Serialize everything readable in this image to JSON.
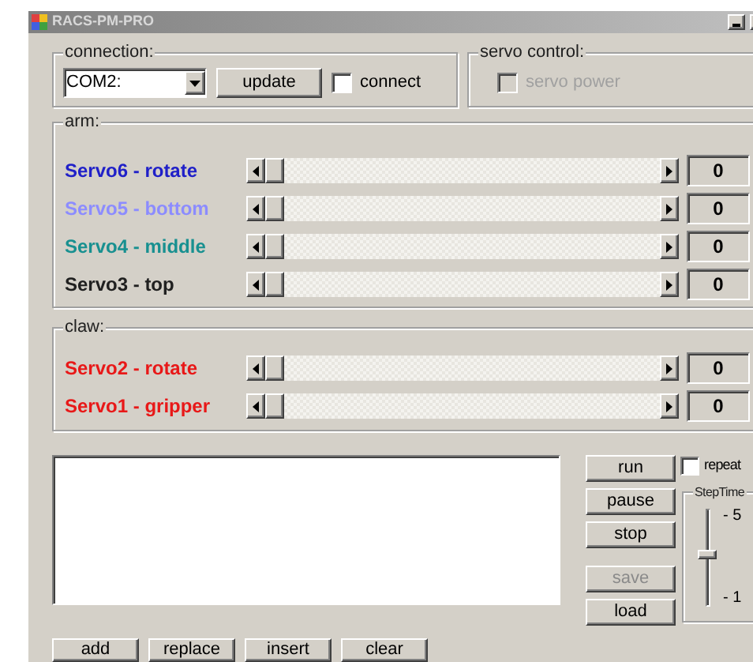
{
  "window": {
    "title": "RACS-PM-PRO"
  },
  "connection": {
    "title": "connection:",
    "port": "COM2:",
    "update_button": "update",
    "connect": {
      "label": "connect",
      "checked": false
    }
  },
  "servo_control": {
    "title": "servo control:",
    "servo_power": {
      "label": "servo power",
      "checked": false,
      "disabled": true
    }
  },
  "arm": {
    "title": "arm:",
    "servos": [
      {
        "name": "Servo6 - rotate",
        "color": "#2020c8",
        "level": 0,
        "value": "0"
      },
      {
        "name": "Servo5 - bottom",
        "color": "#8c8cff",
        "level": 0,
        "value": "0"
      },
      {
        "name": "Servo4 - middle",
        "color": "#189090",
        "level": 0,
        "value": "0"
      },
      {
        "name": "Servo3 - top",
        "color": "#202020",
        "level": 0,
        "value": "0"
      }
    ]
  },
  "claw": {
    "title": "claw:",
    "servos": [
      {
        "name": "Servo2 - rotate",
        "color": "#e81818",
        "level": 0,
        "value": "0"
      },
      {
        "name": "Servo1 - gripper",
        "color": "#e81818",
        "level": 0,
        "value": "0"
      }
    ]
  },
  "sequence_buttons": [
    {
      "label": "run",
      "disabled": false
    },
    {
      "label": "pause",
      "disabled": false
    },
    {
      "label": "stop",
      "disabled": false
    },
    {
      "label": "save",
      "disabled": true
    },
    {
      "label": "load",
      "disabled": false
    }
  ],
  "repeat": {
    "label": "repeat",
    "checked": false
  },
  "step_time": {
    "title": "StepTime",
    "max_label": "- 5",
    "min_label": "- 1",
    "level": 0.53
  },
  "edit_buttons": [
    "add",
    "replace",
    "insert",
    "clear"
  ]
}
